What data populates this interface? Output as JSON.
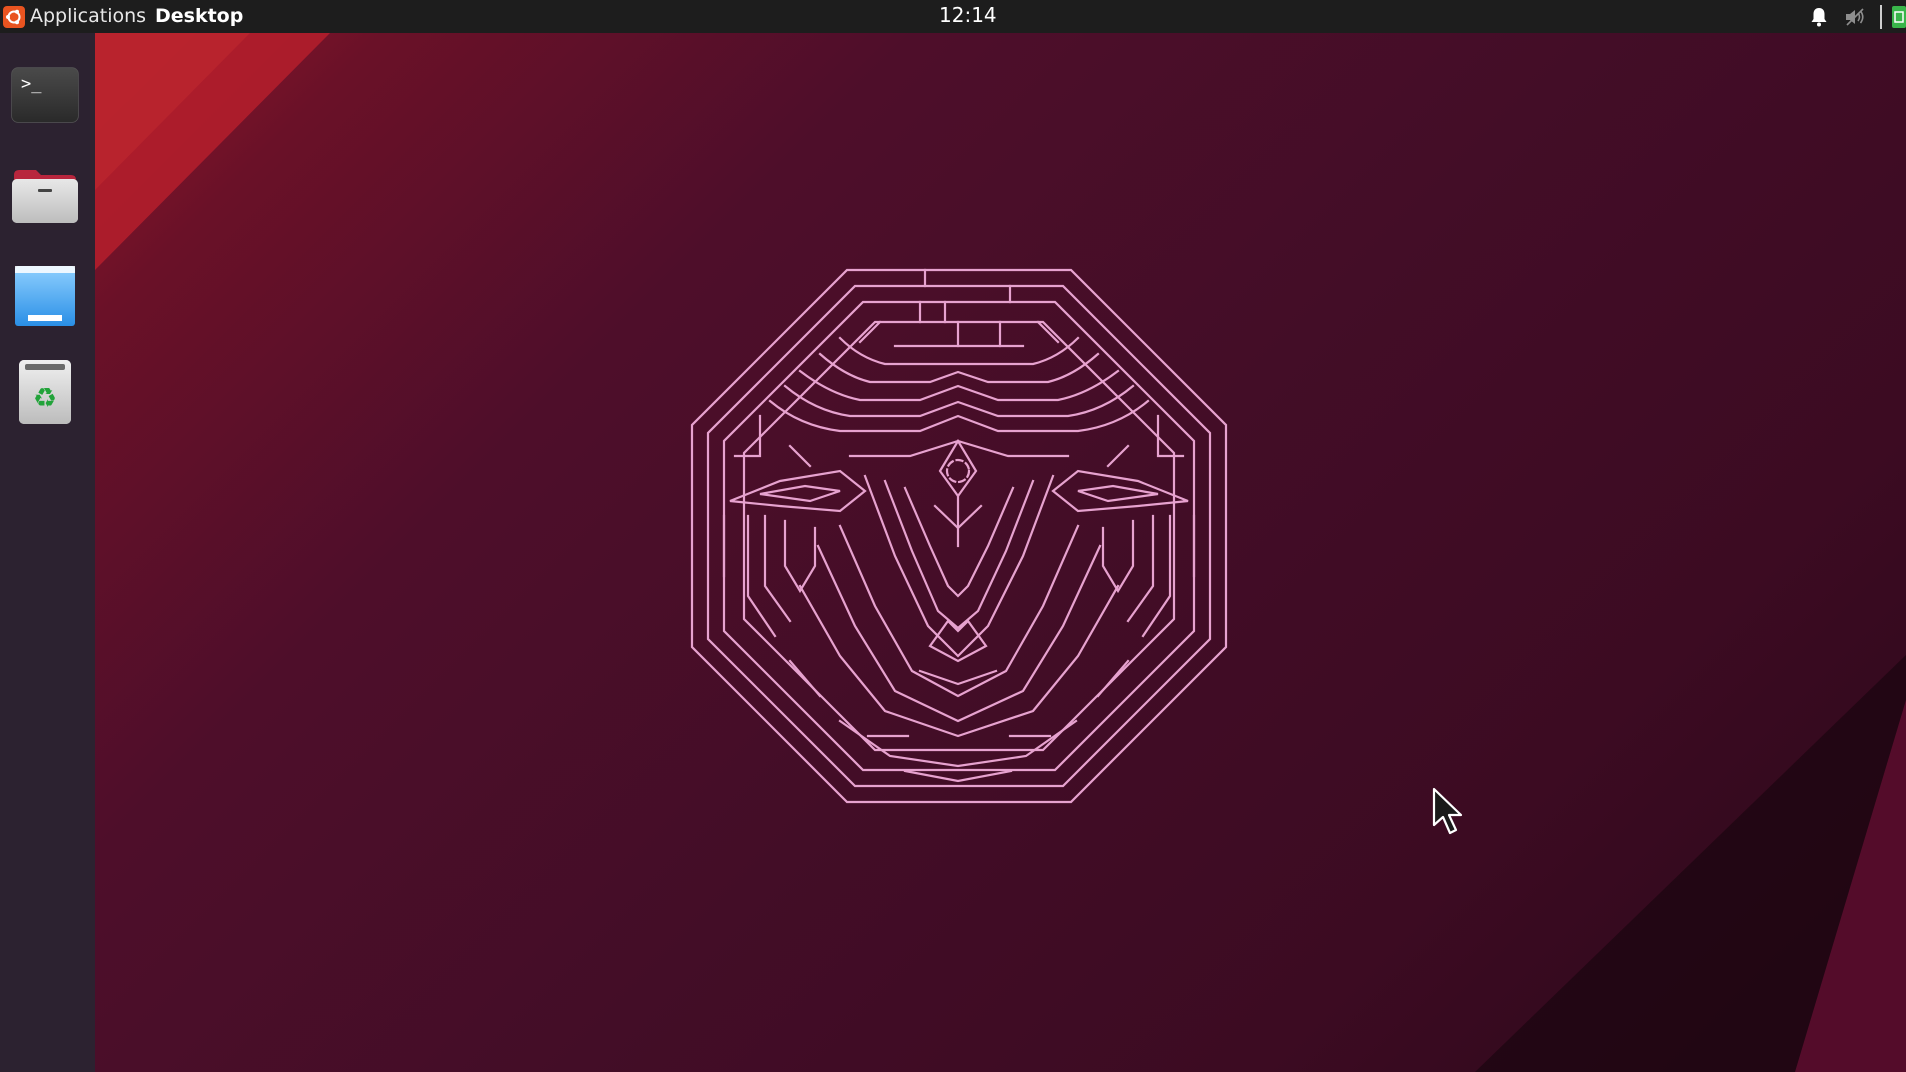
{
  "top_panel": {
    "applications_label": "Applications",
    "window_title": "Desktop",
    "clock": "12:14",
    "tray_icons": [
      "bell-icon",
      "volume-muted-icon",
      "battery-icon"
    ]
  },
  "dock": {
    "items": [
      {
        "icon": "terminal-icon",
        "label": "Terminal"
      },
      {
        "icon": "folder-icon",
        "label": "Files"
      },
      {
        "icon": "window-icon",
        "label": "Window"
      },
      {
        "icon": "trash-icon",
        "label": "Trash"
      }
    ]
  },
  "desktop": {
    "wallpaper": "ubuntu-mascot-emblem",
    "colors": {
      "accent_red": "#a3172d",
      "background": "#430d27",
      "emblem_line": "#e7a2cf",
      "panel": "#1d1d1d",
      "dock": "#2c2230"
    }
  }
}
